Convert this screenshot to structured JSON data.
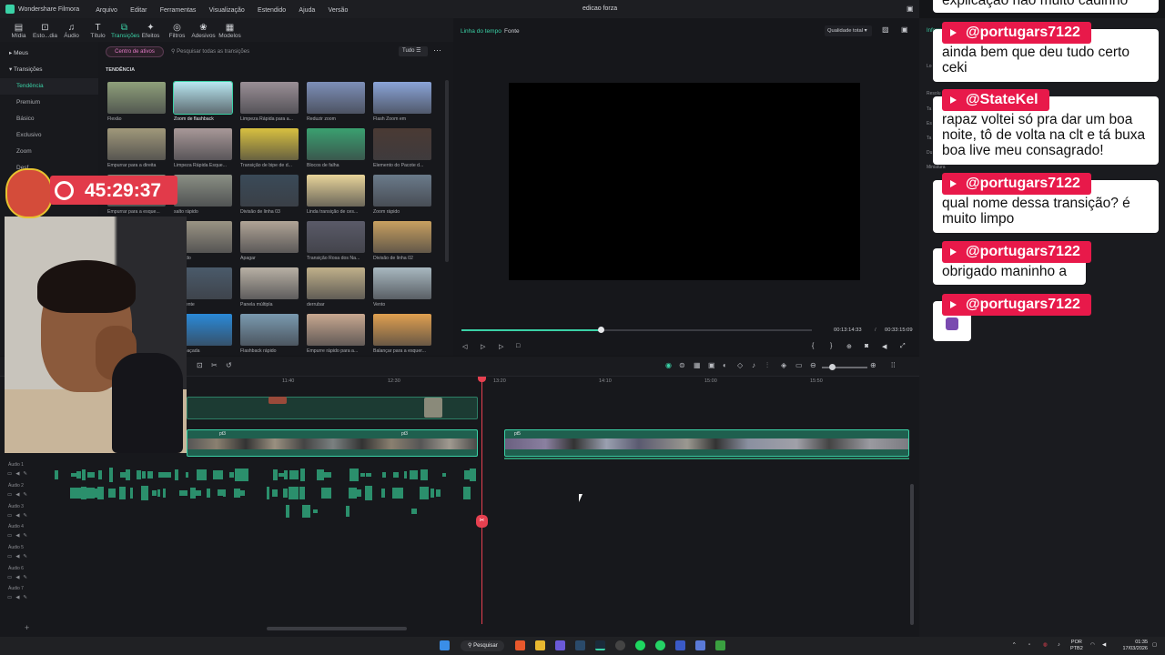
{
  "app": {
    "name": "Wondershare Filmora",
    "menu": [
      "Arquivo",
      "Editar",
      "Ferramentas",
      "Visualização",
      "Estendido",
      "Ajuda",
      "Versão"
    ],
    "doc_title": "edicao forza"
  },
  "toolbar": [
    {
      "label": "Mídia",
      "icon": "media-icon"
    },
    {
      "label": "Esto...dia",
      "icon": "stock-icon"
    },
    {
      "label": "Áudio",
      "icon": "music-icon"
    },
    {
      "label": "Título",
      "icon": "title-icon"
    },
    {
      "label": "Transições",
      "icon": "transition-icon",
      "active": true
    },
    {
      "label": "Efeitos",
      "icon": "effects-icon"
    },
    {
      "label": "Filtros",
      "icon": "filter-icon"
    },
    {
      "label": "Adesivos",
      "icon": "sticker-icon"
    },
    {
      "label": "Modelos",
      "icon": "template-icon"
    }
  ],
  "sidebar": {
    "items": [
      {
        "label": "Meus",
        "head": true
      },
      {
        "label": "Transições",
        "head": true
      },
      {
        "label": "Tendência",
        "active": true
      },
      {
        "label": "Premium"
      },
      {
        "label": "Básico"
      },
      {
        "label": "Exclusivo"
      },
      {
        "label": "Zoom"
      },
      {
        "label": "Desf..."
      }
    ]
  },
  "library": {
    "assets_button": "Centro de ativos",
    "search_placeholder": "Pesquisar todas as transições",
    "filter": "Tudo",
    "section": "TENDÊNCIA",
    "items": [
      {
        "label": "Flexão",
        "bg": "#8fa07a"
      },
      {
        "label": "Zoom de flashback",
        "bg": "#b8e6f0",
        "selected": true
      },
      {
        "label": "Limpeza Rápida para a...",
        "bg": "#9a8f96"
      },
      {
        "label": "Reduzir zoom",
        "bg": "#7d8fb8"
      },
      {
        "label": "Flash Zoom em",
        "bg": "#8aa4d8"
      },
      {
        "label": "Empurrar para a direita",
        "bg": "#a0987a"
      },
      {
        "label": "Limpeza Rápida Esque...",
        "bg": "#a89898"
      },
      {
        "label": "Transição de bipe de d...",
        "bg": "#d8c040"
      },
      {
        "label": "Blocos de falha",
        "bg": "#3aa070"
      },
      {
        "label": "Elemento do Pacote d...",
        "bg": "#4a3a34"
      },
      {
        "label": "Empurrar para a esque...",
        "bg": "#7a8a7a"
      },
      {
        "label": "salto rápido",
        "bg": "#8a8f84"
      },
      {
        "label": "Divisão de linha 03",
        "bg": "#3a4a58"
      },
      {
        "label": "Linda transição de ces...",
        "bg": "#e8d49a"
      },
      {
        "label": "Zoom rápido",
        "bg": "#6a7a8a"
      },
      {
        "label": "o rápido",
        "bg": "#9a9484"
      },
      {
        "label": "Apagar",
        "bg": "#b0a496"
      },
      {
        "label": "Transição Rosa dos Na...",
        "bg": "#5a5a68"
      },
      {
        "label": "Divisão de linha 02",
        "bg": "#c8a060"
      },
      {
        "label": "n da lente",
        "bg": "#4a5a6a"
      },
      {
        "label": "Panela múltipla",
        "bg": "#b8b0a4"
      },
      {
        "label": "derrubar",
        "bg": "#c0b08a"
      },
      {
        "label": "Vento",
        "bg": "#a8b8c0"
      },
      {
        "label": "o embaçada",
        "bg": "#2a8ad8"
      },
      {
        "label": "Flashback rápido",
        "bg": "#7a9ab0"
      },
      {
        "label": "Empurre rápido para a...",
        "bg": "#c8a890"
      },
      {
        "label": "Balançar para a esquer...",
        "bg": "#e0a050"
      }
    ]
  },
  "player": {
    "tab_timeline": "Linha do tempo",
    "tab_source": "Fonte",
    "quality": "Qualidade total",
    "current_time": "00:13:14:33",
    "separator": "/",
    "total_time": "00:33:15:09",
    "progress": 0.397
  },
  "timeline": {
    "ruler": [
      "11:40",
      "12:30",
      "13:20",
      "14:10",
      "15:00",
      "15:50"
    ],
    "video_clip_labels": [
      "pt3",
      "pt3",
      "pt3",
      "pt5"
    ],
    "tracks": [
      "Áudio 1",
      "Áudio 2",
      "Áudio 3",
      "Áudio 4",
      "Áudio 5",
      "Áudio 6",
      "Áudio 7"
    ]
  },
  "overlay": {
    "timer": "45:29:37"
  },
  "right_panel": {
    "title": "Inform",
    "labels": [
      "Lo",
      "Resolu",
      "Ta",
      "Es",
      "Ta",
      "Du",
      "Miniatura"
    ]
  },
  "chat": {
    "top_partial": "explicação não muito cadinho",
    "messages": [
      {
        "user": "@portugars7122",
        "text": "ainda bem que deu tudo certo ceki"
      },
      {
        "user": "@StateKel",
        "text": "rapaz voltei só pra dar um boa noite, tô de volta na clt e tá buxa boa live meu consagrado!"
      },
      {
        "user": "@portugars7122",
        "text": "qual nome dessa transição? é muito limpo"
      },
      {
        "user": "@portugars7122",
        "text": "obrigado maninho a"
      },
      {
        "user": "@portugars7122",
        "text": ""
      }
    ]
  },
  "taskbar": {
    "search": "Pesquisar",
    "lang_top": "POR",
    "lang_bottom": "PTB2",
    "time": "01:35",
    "date": "17/03/2026"
  }
}
